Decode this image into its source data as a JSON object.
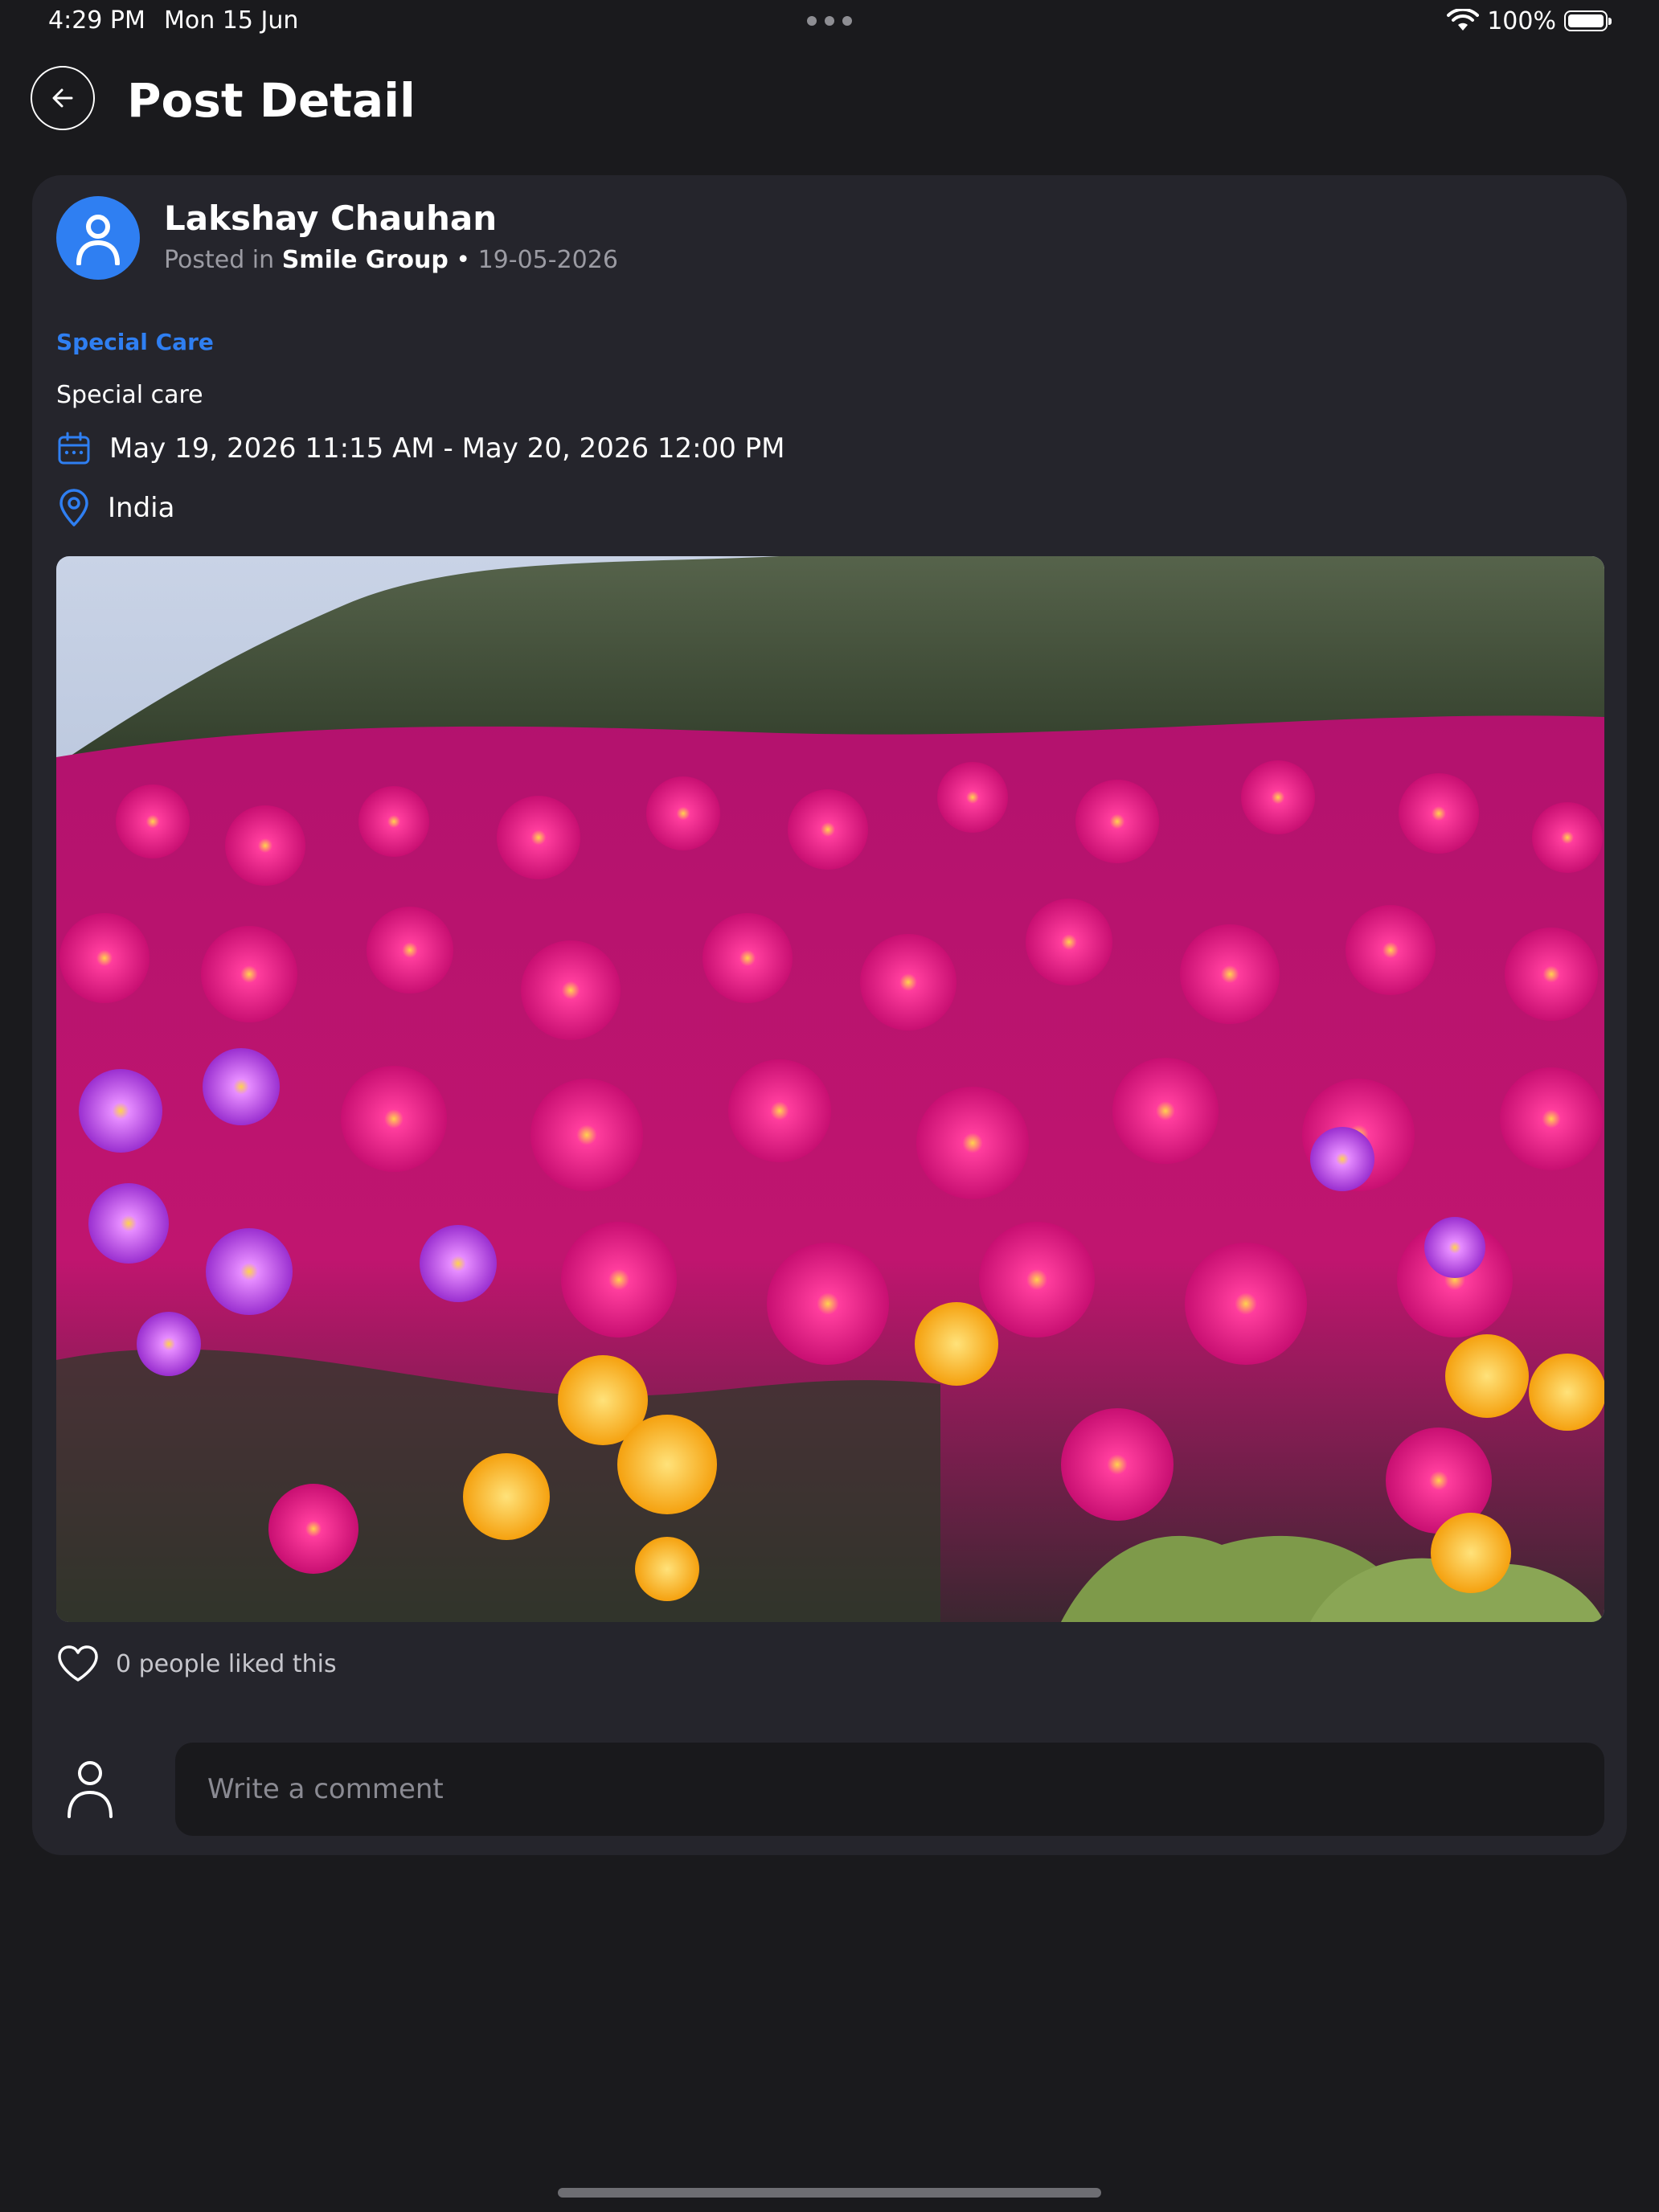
{
  "status_bar": {
    "time": "4:29 PM",
    "date": "Mon 15 Jun",
    "battery": "100%"
  },
  "header": {
    "title": "Post Detail"
  },
  "post": {
    "author": "Lakshay Chauhan",
    "meta_prefix": "Posted in",
    "group": "Smile Group",
    "separator": "•",
    "posted_date": "19-05-2026",
    "category": "Special Care",
    "text": "Special care",
    "event_dates": "May 19, 2026 11:15 AM - May 20, 2026 12:00 PM",
    "location": "India",
    "likes_text": "0 people liked this"
  },
  "comment": {
    "placeholder": "Write a comment"
  },
  "colors": {
    "background": "#1a1a1d",
    "card": "#25252c",
    "accent": "#2f7ff2",
    "input_bg": "#19191c"
  },
  "icons": [
    "back-arrow-icon",
    "wifi-icon",
    "battery-icon",
    "user-icon",
    "calendar-icon",
    "location-pin-icon",
    "heart-icon"
  ]
}
